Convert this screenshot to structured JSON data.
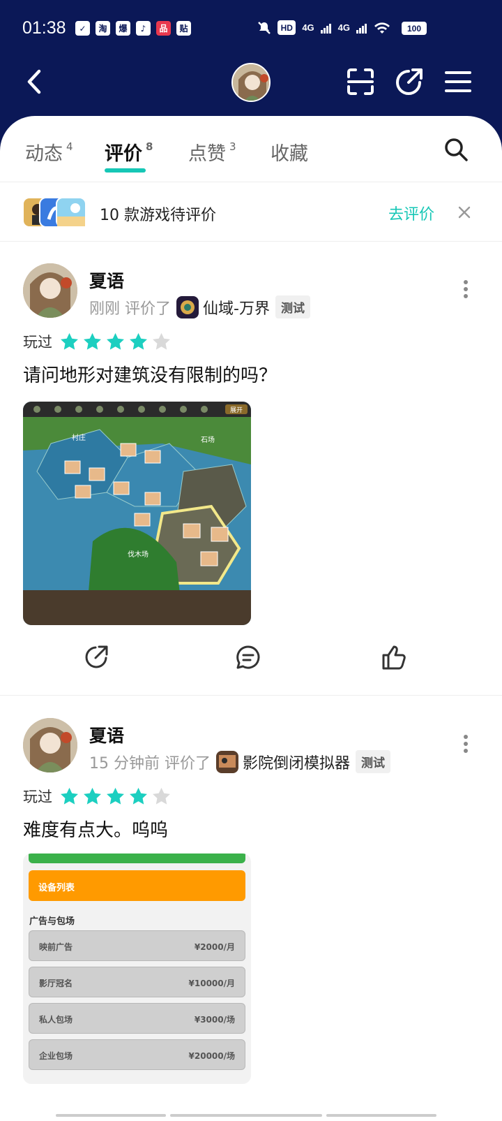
{
  "status_bar": {
    "time": "01:38",
    "notif_icons": [
      "✓",
      "淘",
      "爆",
      "♪",
      "品",
      "贴"
    ],
    "network": [
      "HD",
      "4G",
      "4G"
    ],
    "battery": "100"
  },
  "header": {
    "back_icon": "chevron-left-icon",
    "icons": [
      "scan-icon",
      "share-icon",
      "menu-icon"
    ]
  },
  "tabs": [
    {
      "label": "动态",
      "count": "4"
    },
    {
      "label": "评价",
      "count": "8"
    },
    {
      "label": "点赞",
      "count": "3"
    },
    {
      "label": "收藏",
      "count": ""
    }
  ],
  "pending": {
    "text": "10 款游戏待评价",
    "action": "去评价"
  },
  "reviews": [
    {
      "user": "夏语",
      "time": "刚刚",
      "verb": "评价了",
      "game": "仙域-万界",
      "tag": "测试",
      "played_label": "玩过",
      "rating": 4,
      "text": "请问地形对建筑没有限制的吗？",
      "image_labels": [
        "村庄",
        "伐木场",
        "石场"
      ],
      "image_button": "展开"
    },
    {
      "user": "夏语",
      "time": "15 分钟前",
      "verb": "评价了",
      "game": "影院倒闭模拟器",
      "tag": "测试",
      "played_label": "玩过",
      "rating": 4,
      "text": "难度有点大。呜呜",
      "screen": {
        "orange_title": "设备列表",
        "section": "广告与包场",
        "rows": [
          {
            "label": "映前广告",
            "price": "¥2000/月"
          },
          {
            "label": "影厅冠名",
            "price": "¥10000/月"
          },
          {
            "label": "私人包场",
            "price": "¥3000/场"
          },
          {
            "label": "企业包场",
            "price": "¥20000/场"
          }
        ]
      }
    }
  ],
  "colors": {
    "header_bg": "#0b1857",
    "accent": "#16c7b6",
    "star_on": "#1ccfc0",
    "star_off": "#d9d9d9"
  }
}
